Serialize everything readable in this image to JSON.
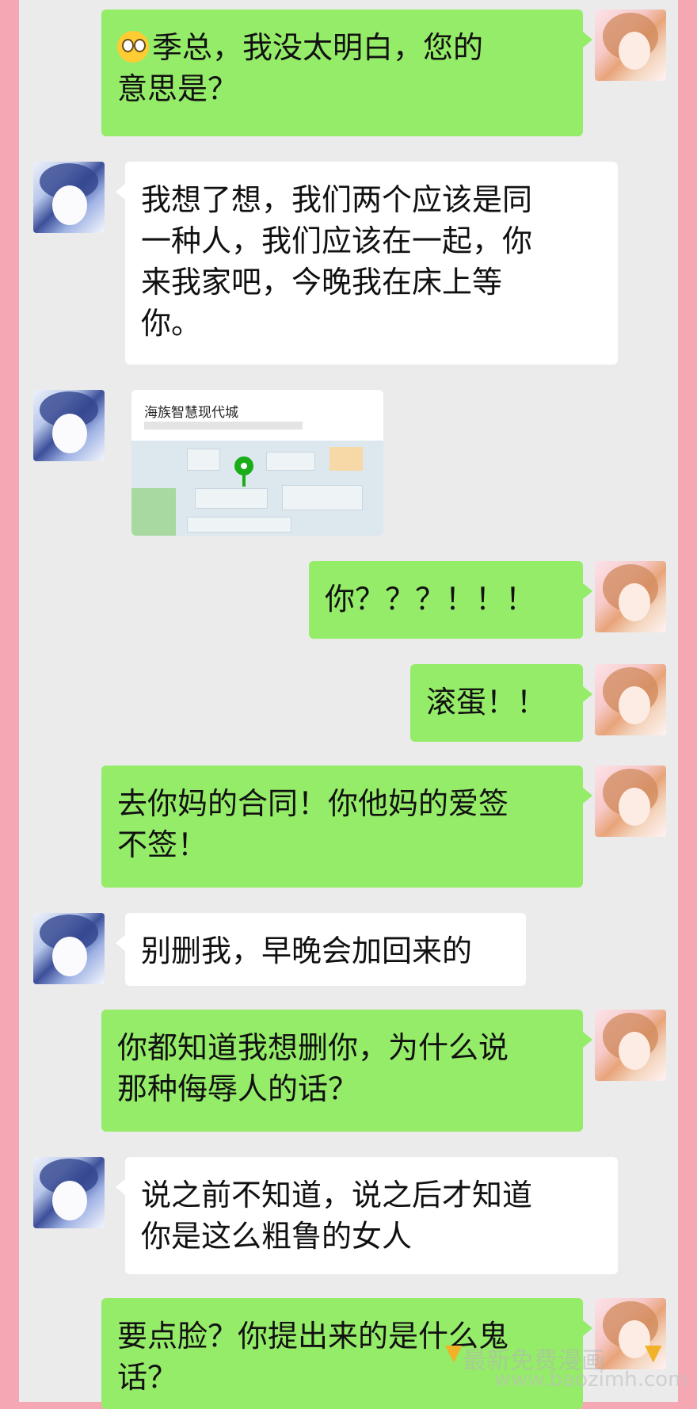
{
  "messages": [
    {
      "from": "her",
      "text": "季总，我没太明白，您的\n意思是？",
      "emoji": "flushed-face"
    },
    {
      "from": "him",
      "text": "我想了想，我们两个应该是同\n一种人，我们应该在一起，你\n来我家吧，今晚我在床上等\n你。"
    },
    {
      "from": "him",
      "type": "location",
      "title": "海族智慧现代城"
    },
    {
      "from": "her",
      "text": "你？？？！！！"
    },
    {
      "from": "her",
      "text": "滚蛋！！"
    },
    {
      "from": "her",
      "text": "去你妈的合同！你他妈的爱签\n不签！"
    },
    {
      "from": "him",
      "text": "别删我，早晚会加回来的"
    },
    {
      "from": "her",
      "text": "你都知道我想删你，为什么说\n那种侮辱人的话？"
    },
    {
      "from": "him",
      "text": "说之前不知道，说之后才知道\n你是这么粗鲁的女人"
    },
    {
      "from": "her",
      "text": "要点脸？你提出来的是什么鬼\n话？"
    }
  ],
  "watermark": {
    "text": "最新免费漫画",
    "url": "www.baozimh.com"
  },
  "colors": {
    "page_border": "#f6a7b4",
    "chat_bg": "#ebebeb",
    "bubble_self": "#95ec69",
    "bubble_other": "#ffffff"
  }
}
